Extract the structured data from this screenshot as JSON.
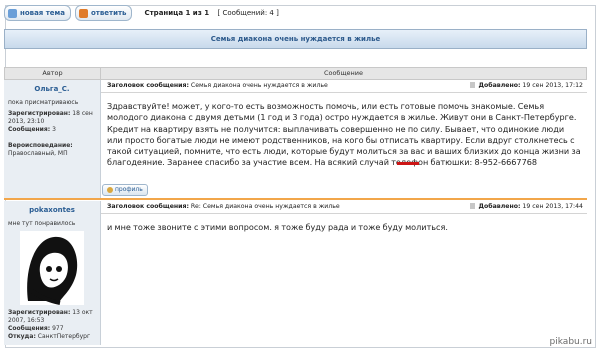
{
  "toolbar": {
    "new_topic": "новая тема",
    "reply": "ответить",
    "page_info": "Страница 1 из 1",
    "message_count": "[ Сообщений: 4 ]"
  },
  "topic_title": "Семья диакона очень нуждается в жилье",
  "columns": {
    "author": "Автор",
    "message": "Сообщение"
  },
  "posts": [
    {
      "author": "Ольга_С.",
      "rank": "пока присматриваюсь",
      "registered_label": "Зарегистрирован:",
      "registered": "18 сен 2013, 23:10",
      "messages_label": "Сообщения:",
      "messages": "3",
      "religion_label": "Вероисповедание:",
      "religion": "Православный, МП",
      "subject_label": "Заголовок сообщения:",
      "subject": "Семья диакона очень нуждается в жилье",
      "date_label": "Добавлено:",
      "date": "19 сен 2013, 17:12",
      "body": "Здравствуйте! может, у кого-то есть возможность помочь, или есть готовые помочь знакомые. Семья молодого диакона с двумя детьми (1 год и 3 года) остро нуждается в жилье. Живут они в Санкт-Петербурге. Кредит на квартиру взять не получится: выплачивать совершенно не по силу. Бывает, что одинокие люди или просто богатые люди не имеют родственников, на кого бы отписать квартиру. Если вдруг столкнетесь с такой ситуацией, помните, что есть люди, которые будут молиться за вас и ваших близких до конца жизни за благодеяние. Заранее спасибо за участие всем. На всякий случай телефон батюшки: 8-952-6667768",
      "profile_button": "профиль"
    },
    {
      "author": "pokaxontes",
      "rank": "мне тут понравилось",
      "registered_label": "Зарегистрирован:",
      "registered": "13 окт 2007, 16:53",
      "messages_label": "Сообщения:",
      "messages": "977",
      "location_label": "Откуда:",
      "location": "СанктПетербург",
      "subject_label": "Заголовок сообщения:",
      "subject": "Re: Семья диакона очень нуждается в жилье",
      "date_label": "Добавлено:",
      "date": "19 сен 2013, 17:44",
      "body": "и мне тоже звоните с этими вопросом. я тоже буду рада и тоже буду молиться."
    }
  ],
  "watermark": "pikabu.ru",
  "colors": {
    "link": "#2a5d93",
    "accent": "#f2a64a",
    "underline": "#cc1515"
  }
}
